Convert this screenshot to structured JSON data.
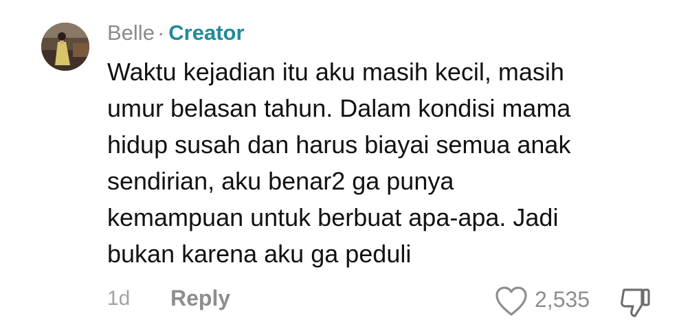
{
  "comment": {
    "author": "Belle",
    "separator": "·",
    "badge": "Creator",
    "text_lines": [
      "Waktu kejadian itu aku masih kecil, masih",
      "umur belasan tahun. Dalam kondisi mama",
      "hidup susah dan harus biayai semua anak",
      "sendirian, aku benar2 ga punya",
      "kemampuan untuk berbuat apa-apa. Jadi",
      "bukan karena aku ga peduli"
    ],
    "time": "1d",
    "reply_label": "Reply",
    "like_count": "2,535",
    "icons": {
      "like": "heart-icon",
      "dislike": "thumbs-down-icon"
    },
    "colors": {
      "badge": "#1f8a99",
      "meta": "#8d8d91",
      "text": "#111111"
    }
  }
}
